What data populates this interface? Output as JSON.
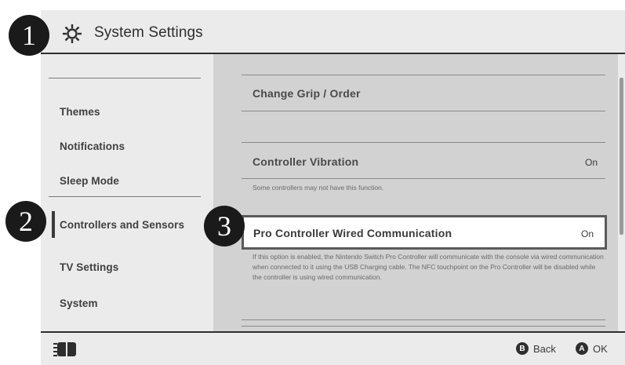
{
  "header": {
    "title": "System Settings",
    "icon": "gear-icon"
  },
  "sidebar": {
    "items": [
      {
        "label": "Themes"
      },
      {
        "label": "Notifications"
      },
      {
        "label": "Sleep Mode"
      },
      {
        "label": "Controllers and Sensors",
        "selected": true
      },
      {
        "label": "TV Settings"
      },
      {
        "label": "System"
      }
    ]
  },
  "main": {
    "rows": [
      {
        "label": "Change Grip / Order"
      },
      {
        "label": "Controller Vibration",
        "value": "On",
        "description": "Some controllers may not have this function."
      },
      {
        "label": "Pro Controller Wired Communication",
        "value": "On",
        "selected": true,
        "description": "If this option is enabled, the Nintendo Switch Pro Controller will communicate with the console via wired communication when connected to it using the USB Charging cable. The NFC touchpoint on the Pro Controller will be disabled while the controller is using wired communication."
      }
    ]
  },
  "footer": {
    "back": {
      "glyph": "B",
      "label": "Back"
    },
    "ok": {
      "glyph": "A",
      "label": "OK"
    }
  },
  "callouts": [
    "1",
    "2",
    "3"
  ],
  "colors": {
    "badge": "#1a1a1a",
    "background": "#ebebeb",
    "panel": "#d2d2d2",
    "selected": "#ffffff"
  }
}
